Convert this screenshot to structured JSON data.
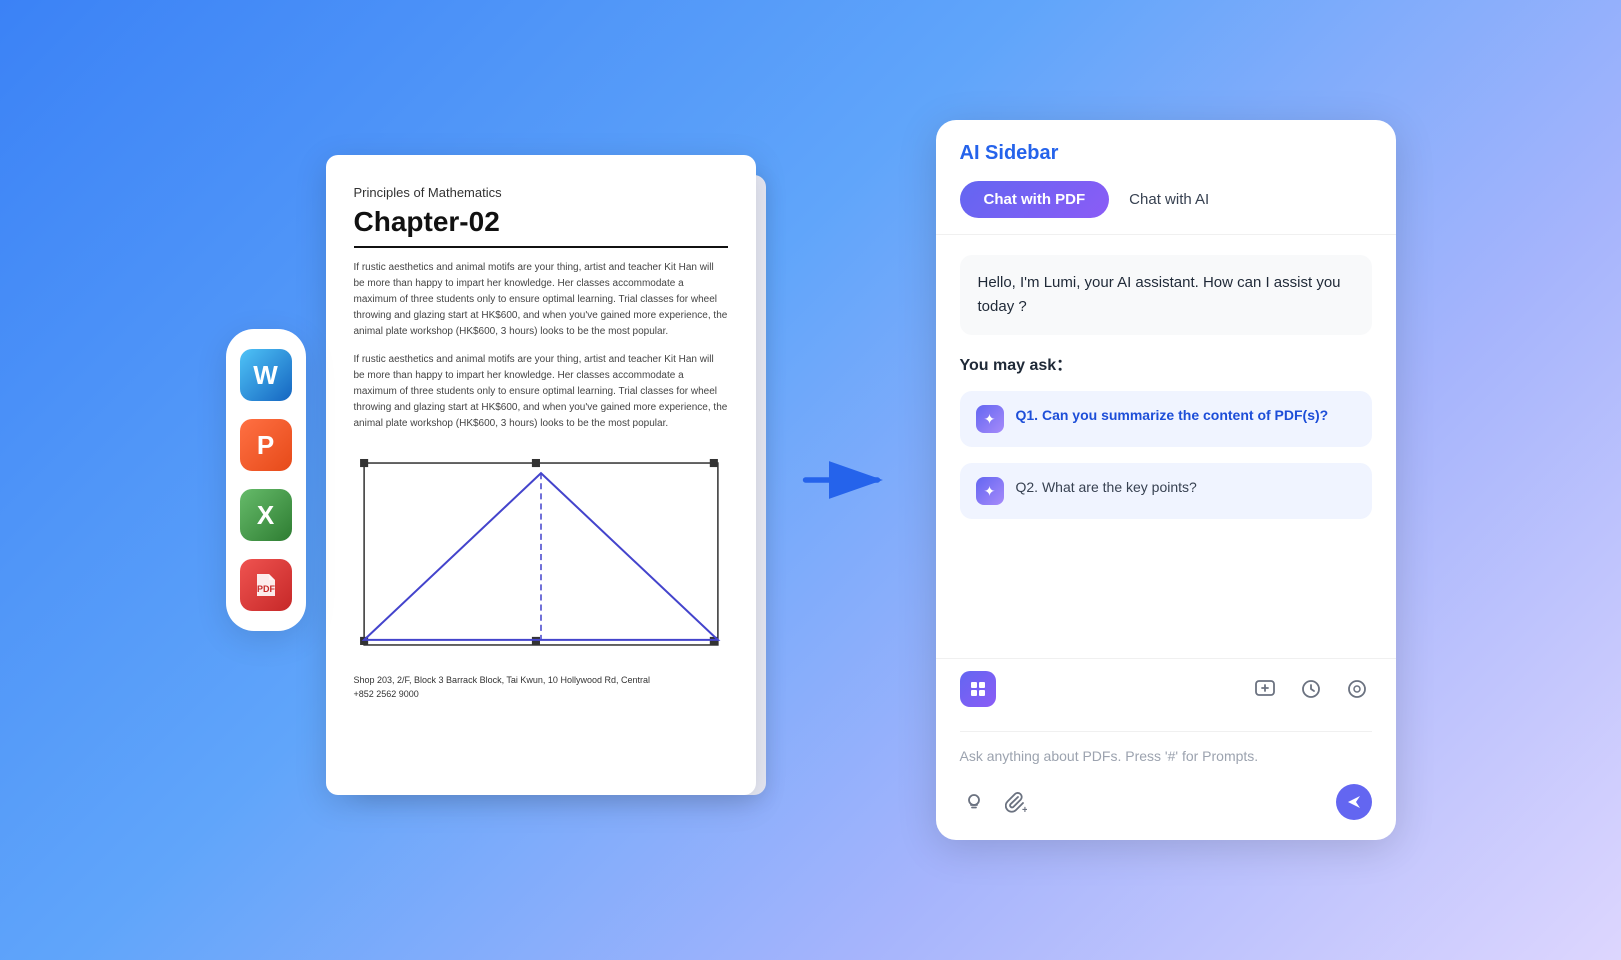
{
  "background": {
    "gradient_start": "#3b82f6",
    "gradient_end": "#ddd6fe"
  },
  "app_icons": [
    {
      "id": "word",
      "label": "W",
      "class": "app-icon-word"
    },
    {
      "id": "ppt",
      "label": "P",
      "class": "app-icon-ppt"
    },
    {
      "id": "excel",
      "label": "X",
      "class": "app-icon-excel"
    },
    {
      "id": "pdf",
      "label": "",
      "class": "app-icon-pdf"
    }
  ],
  "pdf_document": {
    "subtitle": "Principles of Mathematics",
    "title": "Chapter-02",
    "text_block_1": "If rustic aesthetics and animal motifs are your thing, artist and teacher Kit Han will be more than happy to impart her knowledge. Her classes accommodate a maximum of three students only to ensure optimal learning. Trial classes for wheel throwing and glazing start at HK$600, and when you've gained more experience, the animal plate workshop (HK$600, 3 hours) looks to be the most popular.",
    "text_block_2": "If rustic aesthetics and animal motifs are your thing, artist and teacher Kit Han will be more than happy to impart her knowledge. Her classes accommodate a maximum of three students only to ensure optimal learning. Trial classes for wheel throwing and glazing start at HK$600, and when you've gained more experience, the animal plate workshop (HK$600, 3 hours) looks to be the most popular.",
    "footer_line1": "Shop 203, 2/F, Block 3 Barrack Block, Tai Kwun, 10 Hollywood Rd, Central",
    "footer_line2": "+852 2562 9000"
  },
  "ai_sidebar": {
    "title": "AI Sidebar",
    "tab_chat_pdf": "Chat with PDF",
    "tab_chat_ai": "Chat with AI",
    "greeting": "Hello, I'm Lumi, your AI assistant. How can I assist you today ?",
    "you_may_ask": "You may ask：",
    "questions": [
      {
        "id": "q1",
        "text": "Q1. Can you summarize the content of PDF(s)?",
        "highlighted": true
      },
      {
        "id": "q2",
        "text": "Q2. What are the key points?",
        "highlighted": false
      }
    ],
    "input_placeholder": "Ask anything about PDFs. Press '#' for Prompts.",
    "send_icon": "▶"
  }
}
